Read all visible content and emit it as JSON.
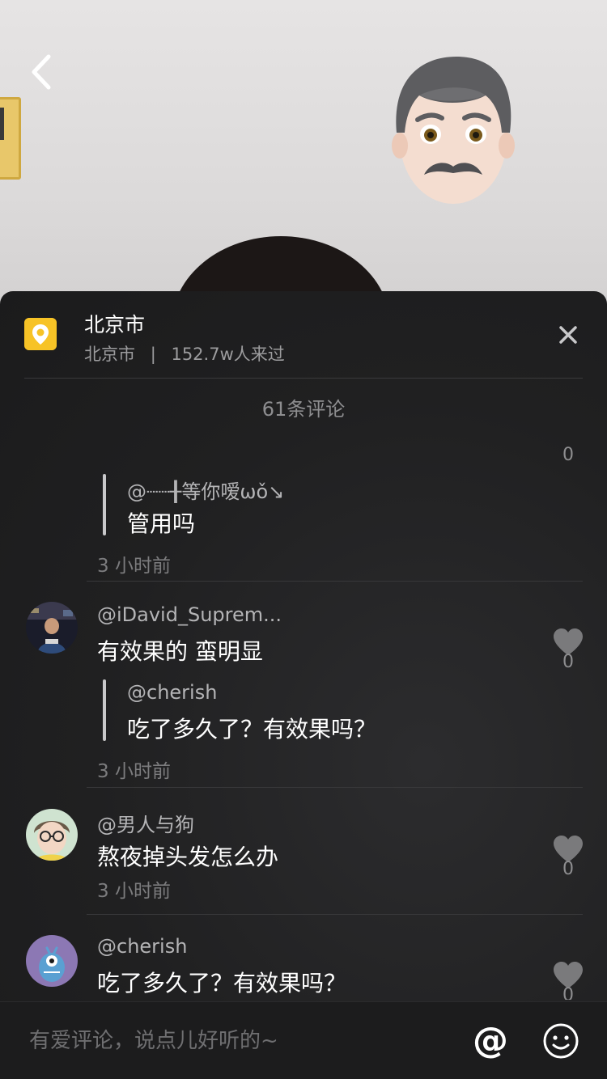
{
  "location": {
    "name": "北京市",
    "city": "北京市",
    "separator": "|",
    "visitors": "152.7w人来过"
  },
  "comments_header": {
    "count_label": "61条评论"
  },
  "comments": [
    {
      "likes": "0",
      "reply": {
        "user": "@┈┈╂等你嗳ωǒ↘",
        "text": "管用吗"
      },
      "time": "3 小时前"
    },
    {
      "username": "@iDavid_Suprem...",
      "text": "有效果的 蛮明显",
      "likes": "0",
      "reply": {
        "user": "@cherish",
        "text": "吃了多久了？有效果吗？"
      },
      "time": "3 小时前"
    },
    {
      "username": "@男人与狗",
      "text": "熬夜掉头发怎么办",
      "likes": "0",
      "time": "3 小时前"
    },
    {
      "username": "@cherish",
      "text": "吃了多久了？有效果吗？",
      "likes": "0"
    }
  ],
  "input": {
    "placeholder": "有爱评论，说点儿好听的~",
    "value": "",
    "mention_label": "@"
  },
  "icons": {
    "back": "chevron-left-icon",
    "place": "location-pin-icon",
    "close": "close-icon",
    "like": "heart-icon",
    "emoji": "smiley-icon"
  },
  "colors": {
    "sheet_background": "#1e1e1f",
    "place_icon": "#f7c326",
    "primary_text": "#ffffff",
    "secondary_text": "#8e8e90"
  }
}
